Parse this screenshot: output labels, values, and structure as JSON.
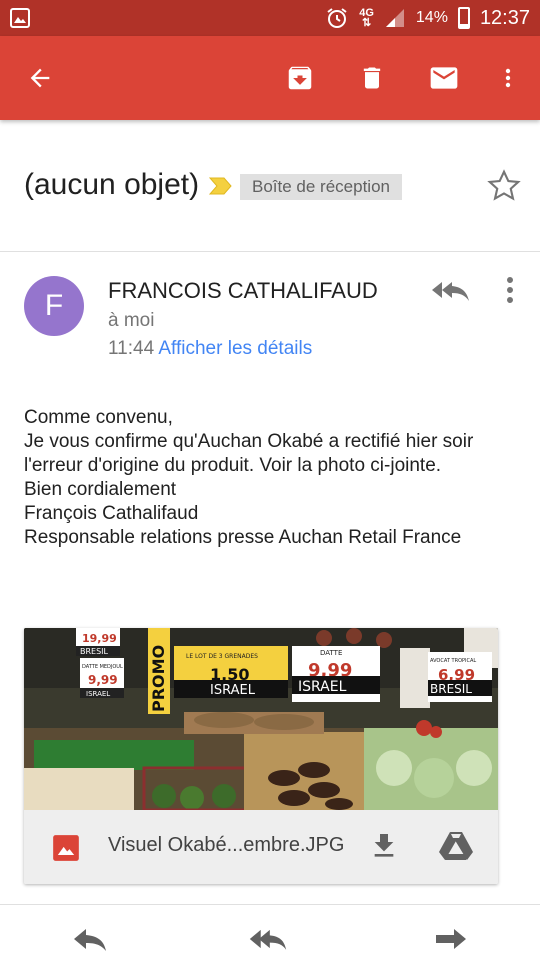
{
  "status_bar": {
    "network": "4G",
    "battery_percent": "14%",
    "time": "12:37"
  },
  "toolbar": {
    "back_icon": "arrow-back-icon",
    "archive_icon": "archive-icon",
    "delete_icon": "delete-icon",
    "mark_unread_icon": "mail-icon",
    "more_icon": "more-vert-icon"
  },
  "email": {
    "subject": "(aucun objet)",
    "label": "Boîte de réception",
    "sender_initial": "F",
    "sender_name": "FRANCOIS CATHALIFAUD",
    "recipient": "à moi",
    "time": "11:44",
    "details_link": "Afficher les détails",
    "body_lines": [
      "Comme convenu,",
      "Je vous confirme qu'Auchan Okabé a rectifié hier soir l'erreur d'origine du produit. Voir la photo ci-jointe.",
      "Bien cordialement",
      "François Cathalifaud",
      "Responsable relations presse Auchan Retail France"
    ]
  },
  "attachment": {
    "filename": "Visuel Okabé...embre.JPG",
    "photo_signs": {
      "price_left": "19,99",
      "brand_left": "BRESIL",
      "datte_mesure": "DATTE MEDJOUL",
      "price_mid_left": "9,99",
      "israel_small": "ISRAEL",
      "promo": "PROMO",
      "grenades_title": "LE LOT DE 3 GRENADES",
      "grenades_price": "1,50",
      "grenades_origin": "ISRAEL",
      "datte_label": "DATTE",
      "datte_price": "9,99",
      "datte_origin": "ISRAEL",
      "avocat_label": "AVOCAT TROPICAL",
      "avocat_price": "6,99",
      "avocat_origin": "BRESIL"
    }
  },
  "colors": {
    "toolbar": "#db4437",
    "status_bar": "#b03228",
    "avatar": "#9575cd",
    "link": "#4285f4",
    "importance": "#f4d03f"
  }
}
